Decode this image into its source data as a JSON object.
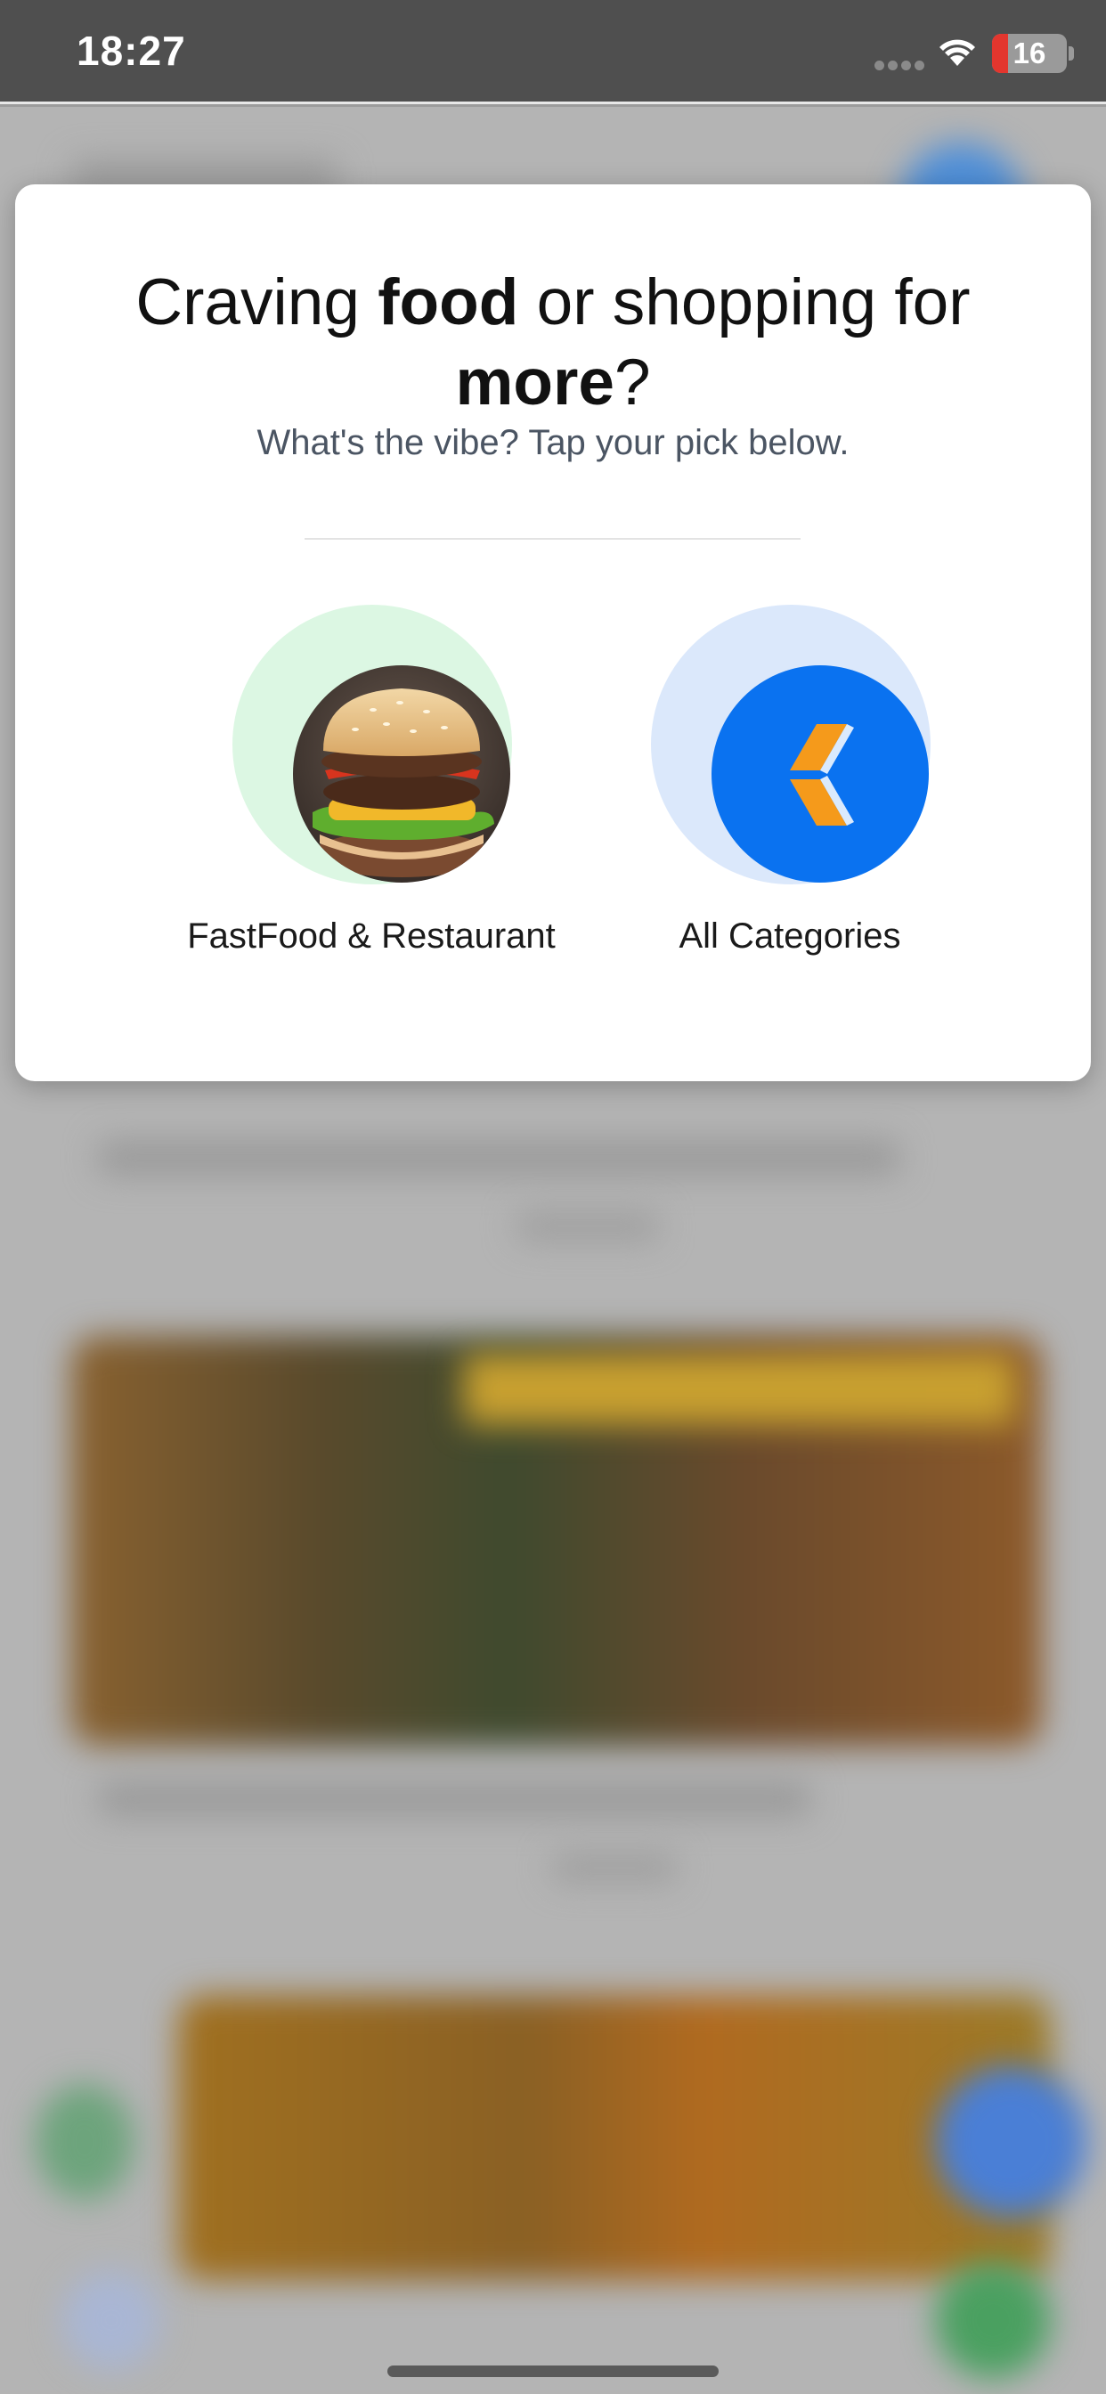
{
  "status_bar": {
    "time": "18:27",
    "battery_level": "16",
    "icons": [
      "signal-icon",
      "wifi-icon",
      "battery-icon"
    ]
  },
  "modal": {
    "title_part1": "Craving ",
    "title_bold1": "food",
    "title_part2": " or shopping for ",
    "title_bold2": "more",
    "title_part3": "?",
    "subtitle": "What's the vibe? Tap your pick below.",
    "options": [
      {
        "label": "FastFood & Restaurant",
        "icon": "burger-icon"
      },
      {
        "label": "All Categories",
        "icon": "all-categories-logo-icon"
      }
    ]
  },
  "colors": {
    "food_halo": "#dcf7e3",
    "categories_halo": "#dbe8fb",
    "categories_disc": "#0a72f0",
    "logo_orange": "#f59a1b",
    "battery_low": "#e3362e"
  }
}
